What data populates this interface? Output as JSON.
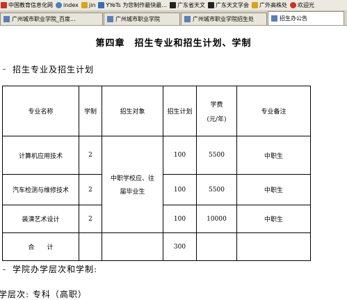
{
  "bookmarks": [
    {
      "label": "中国教育信息化网",
      "icon": "red-square-icon",
      "color": "#c8322a"
    },
    {
      "label": "index",
      "icon": "globe-icon",
      "color": "#4a7fc1"
    },
    {
      "label": "jin",
      "icon": "bookmark-icon",
      "color": "#d9a21b"
    },
    {
      "label": "YYeTs 为您制作最快最...",
      "icon": "yyets-icon",
      "color": "#3b6bb5"
    },
    {
      "label": "广东省天文",
      "icon": "star-icon",
      "color": "#222222"
    },
    {
      "label": "广东天文学会",
      "icon": "star-icon",
      "color": "#222222"
    },
    {
      "label": "广外高株处",
      "icon": "page-icon",
      "color": "#d9a21b"
    },
    {
      "label": "欢迎光",
      "icon": "face-icon",
      "color": "#c8322a"
    }
  ],
  "tabs": [
    {
      "label": "广州城市职业学院_百度...",
      "active": false
    },
    {
      "label": "广州城市职业学院",
      "active": false
    },
    {
      "label": "广州城市职业学院招生处",
      "active": false
    },
    {
      "label": "招生办公告",
      "active": true
    }
  ],
  "document": {
    "title": "第四章　招生专业和招生计划、学制",
    "section1": "招生专业及招生计划",
    "section2": "学院办学层次和学制:",
    "level": "学层次: 专科（高职）"
  },
  "table": {
    "headers": {
      "major": "专业名称",
      "duration": "学制",
      "target": "招生对象",
      "plan": "招生计划",
      "fee_line1": "学费",
      "fee_line2": "(元/年)",
      "note": "专业备注"
    },
    "rows": [
      {
        "major": "计算机应用技术",
        "duration": "2",
        "plan": "100",
        "fee": "5500",
        "note": "中职生"
      },
      {
        "major": "汽车检测与维修技术",
        "duration": "2",
        "plan": "100",
        "fee": "5500",
        "note": "中职生"
      },
      {
        "major": "装潢艺术设计",
        "duration": "2",
        "plan": "100",
        "fee": "10000",
        "note": "中职生"
      }
    ],
    "target_line1": "中职学校应、往",
    "target_line2": "届毕业生",
    "total_label": "合　　计",
    "total_plan": "300"
  }
}
